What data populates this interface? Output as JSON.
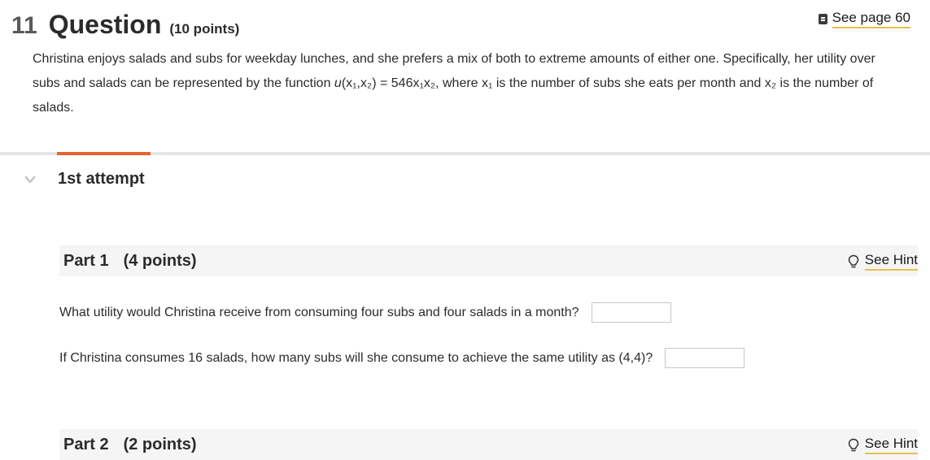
{
  "question": {
    "number": "11",
    "title": "Question",
    "points": "(10 points)",
    "see_page_label": "See page 60"
  },
  "prompt": {
    "line1": "Christina enjoys salads and subs for weekday lunches, and she prefers a mix of both to extreme amounts of either one. Specifically, her utility over",
    "line2_pre": "subs and salads can be represented by the function ",
    "line2_func": "u",
    "line2_args": "(x₁,x₂)",
    "line2_eq": " = 546",
    "line2_vars": "x₁x₂",
    "line2_mid": ", where ",
    "line2_x1": "x₁",
    "line2_mid2": " is the number of subs she eats per month and ",
    "line2_x2": "x₂",
    "line2_post": " is the number of",
    "line3": "salads."
  },
  "attempt": {
    "title": "1st attempt"
  },
  "parts": [
    {
      "label": "Part 1",
      "points": "(4 points)",
      "hint_label": "See Hint",
      "questions": [
        {
          "text": "What utility would Christina receive from consuming four subs and four salads in a month?",
          "value": ""
        },
        {
          "text": "If Christina consumes 16 salads, how many subs will she consume to achieve the same utility as (4,4)?",
          "value": ""
        }
      ]
    },
    {
      "label": "Part 2",
      "points": "(2 points)",
      "hint_label": "See Hint"
    }
  ],
  "colors": {
    "accent": "#e8622f",
    "link_underline": "#e8c14a",
    "part_bar_bg": "#f5f5f5"
  },
  "icons": {
    "see_page": "book-icon",
    "hint": "lightbulb-icon",
    "collapse": "chevron-down-icon"
  }
}
